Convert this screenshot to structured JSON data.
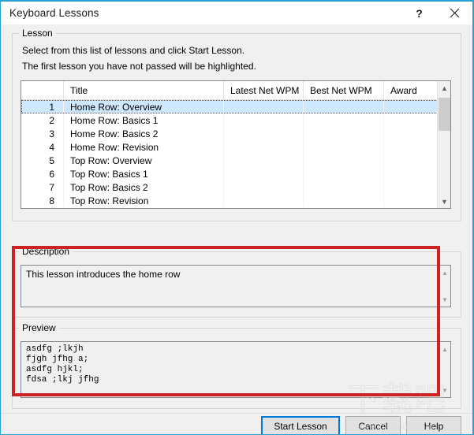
{
  "window": {
    "title": "Keyboard Lessons",
    "help_icon_label": "?",
    "close_icon_label": "✕"
  },
  "lesson_group": {
    "title": "Lesson",
    "instruction_line1": "Select from this list of lessons and click Start Lesson.",
    "instruction_line2": "The first lesson you have not passed will be highlighted.",
    "columns": [
      "",
      "Title",
      "Latest Net WPM",
      "Best Net WPM",
      "Award"
    ],
    "rows": [
      {
        "index": "1",
        "title": "Home Row: Overview",
        "latest": "",
        "best": "",
        "award": "",
        "selected": true
      },
      {
        "index": "2",
        "title": "Home Row: Basics 1",
        "latest": "",
        "best": "",
        "award": "",
        "selected": false
      },
      {
        "index": "3",
        "title": "Home Row: Basics 2",
        "latest": "",
        "best": "",
        "award": "",
        "selected": false
      },
      {
        "index": "4",
        "title": "Home Row: Revision",
        "latest": "",
        "best": "",
        "award": "",
        "selected": false
      },
      {
        "index": "5",
        "title": "Top Row: Overview",
        "latest": "",
        "best": "",
        "award": "",
        "selected": false
      },
      {
        "index": "6",
        "title": "Top Row: Basics 1",
        "latest": "",
        "best": "",
        "award": "",
        "selected": false
      },
      {
        "index": "7",
        "title": "Top Row: Basics 2",
        "latest": "",
        "best": "",
        "award": "",
        "selected": false
      },
      {
        "index": "8",
        "title": "Top Row: Revision",
        "latest": "",
        "best": "",
        "award": "",
        "selected": false
      }
    ]
  },
  "description_group": {
    "title": "Description",
    "text": "This lesson introduces the home row"
  },
  "preview_group": {
    "title": "Preview",
    "text": "asdfg ;lkjh\nfjgh jfhg a;\nasdfg hjkl;\nfdsa ;lkj jfhg"
  },
  "buttons": {
    "start": "Start Lesson",
    "cancel": "Cancel",
    "help": "Help"
  },
  "watermark": {
    "chinese": "下载吧",
    "url": "www.xiazaiba.com"
  },
  "colors": {
    "window_border": "#2a9fd6",
    "selection": "#cde8ff",
    "default_button_border": "#0078d7",
    "annotation": "#cc2222"
  }
}
